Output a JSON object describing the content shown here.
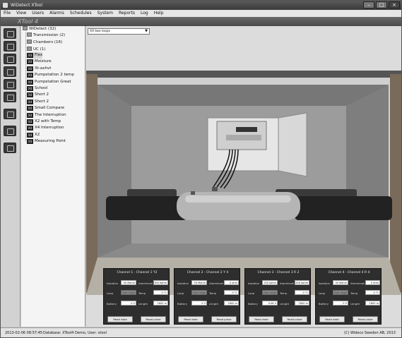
{
  "window": {
    "title": "WiDetect XTool"
  },
  "menu": [
    "File",
    "View",
    "Users",
    "Alarms",
    "Schedules",
    "System",
    "Reports",
    "Log",
    "Help"
  ],
  "banner": "XTool 4",
  "toolbar": [
    "chart-icon",
    "gear-icon",
    "monitor-icon",
    "network-icon",
    "document-icon",
    "settings-grid-icon",
    "camera-icon",
    "calendar-icon",
    "lightning-icon"
  ],
  "tree": {
    "root": "WiDetect (32)",
    "groups": [
      "Transmission (2)",
      "Chambers (16)",
      "UC (1)"
    ],
    "items": [
      "Flex",
      "Moisture",
      "Xt-axhvt",
      "Pumpstation 2 temp",
      "Pumpstation Great",
      "School",
      "Short 2",
      "Short 2",
      "Small Compare",
      "The Interruption",
      "X2 with Temp",
      "X4 Interruption",
      "X2",
      "Measuring Point"
    ],
    "item_badge": "X4",
    "selected_index": 0
  },
  "view_select": {
    "value": "X4 two loops"
  },
  "channels": [
    {
      "title": "Channel 1 - Channel 1 Y2",
      "isolation": "50 Mohm",
      "alarmlevel": "500 Kohm",
      "loop": "Over range",
      "temp": "0 °C",
      "battery": "0 V",
      "length": "1600 m"
    },
    {
      "title": "Channel 2 - Channel 2 Y 4",
      "isolation": "50 Mohm",
      "alarmlevel": "0 ohm",
      "loop": "Over range",
      "temp": "0 °C",
      "battery": "0 V",
      "length": "1600 m"
    },
    {
      "title": "Channel 3 - Channel 3 R 2",
      "isolation": "250 Kohm",
      "alarmlevel": "500 Kohm",
      "loop": "Over range",
      "temp": "0 °C",
      "battery": "0.06 V",
      "length": "1600 m"
    },
    {
      "title": "Channel 4 - Channel 4 R 4",
      "isolation": "50 Mohm",
      "alarmlevel": "0 ohm",
      "loop": "Over range",
      "temp": "0 °C",
      "battery": "0 V",
      "length": "1600 m"
    }
  ],
  "labels": {
    "isolation": "Isolation",
    "alarmlevel": "Alarmlevel",
    "loop": "Loop",
    "temp": "Temp",
    "battery": "Battery",
    "length": "Length",
    "read_data": "Read data",
    "read_pulse": "Read pulse"
  },
  "status": {
    "datetime": "2013-02-06 08:57:45",
    "database": "Database: XTool4 Demo, User: xtool",
    "copyright": "(C) Wideco Sweden AB, 2013"
  }
}
